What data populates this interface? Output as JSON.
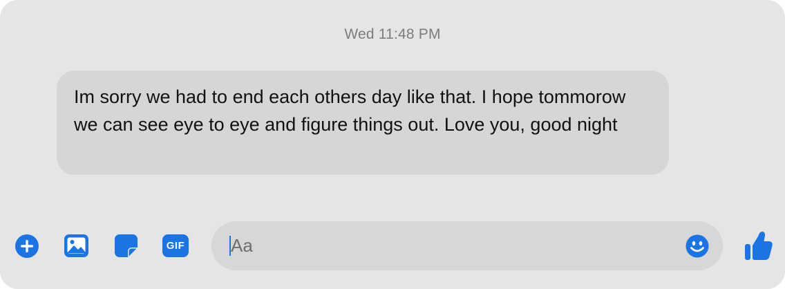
{
  "conversation": {
    "timestamp": "Wed 11:48 PM",
    "messages": [
      {
        "text": "Im sorry we had to end each others day like that. I hope tommorow we can see eye to eye and figure things out. Love you, good night"
      }
    ]
  },
  "composer": {
    "placeholder": "Aa",
    "value": "",
    "icons": [
      "plus-icon",
      "image-icon",
      "sticker-icon",
      "gif-icon",
      "emoji-icon",
      "thumbs-up-icon"
    ],
    "gif_label": "GIF"
  },
  "colors": {
    "accent": "#1b74e4",
    "background": "#e5e5e5",
    "bubble": "#d6d6d6",
    "timestamp_text": "#7c7c7c"
  }
}
